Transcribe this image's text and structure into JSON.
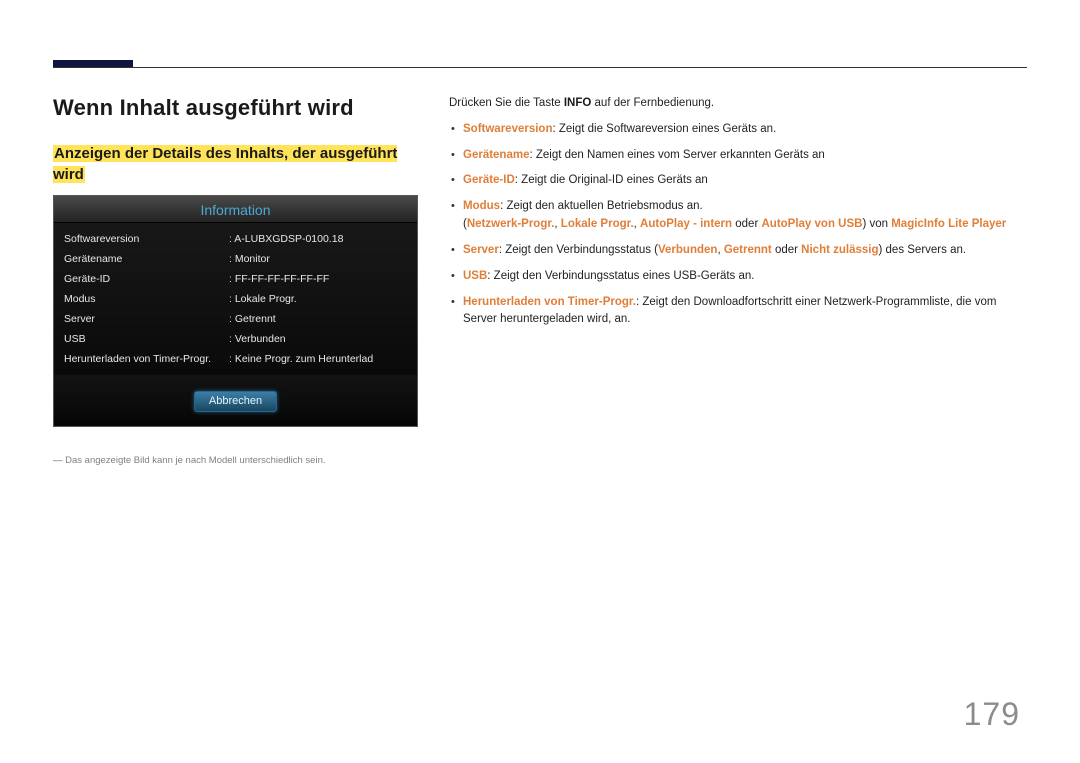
{
  "page_number": "179",
  "heading": "Wenn Inhalt ausgeführt wird",
  "subheading": "Anzeigen der Details des Inhalts, der ausgeführt wird",
  "panel": {
    "title": "Information",
    "rows": [
      {
        "k": "Softwareversion",
        "v": "A-LUBXGDSP-0100.18"
      },
      {
        "k": "Gerätename",
        "v": "Monitor"
      },
      {
        "k": "Geräte-ID",
        "v": "FF-FF-FF-FF-FF-FF"
      },
      {
        "k": "Modus",
        "v": "Lokale Progr."
      },
      {
        "k": "Server",
        "v": "Getrennt"
      },
      {
        "k": "USB",
        "v": "Verbunden"
      },
      {
        "k": "Herunterladen von Timer-Progr.",
        "v": "Keine Progr. zum Herunterlad"
      }
    ],
    "cancel": "Abbrechen"
  },
  "footnote": "Das angezeigte Bild kann je nach Modell unterschiedlich sein.",
  "right": {
    "intro_pre": "Drücken Sie die Taste ",
    "intro_bold": "INFO",
    "intro_post": " auf der Fernbedienung.",
    "items": {
      "softwareversion": {
        "term": "Softwareversion",
        "rest": ": Zeigt die Softwareversion eines Geräts an."
      },
      "geraetename": {
        "term": "Gerätename",
        "rest": ": Zeigt den Namen eines vom Server erkannten Geräts an"
      },
      "geraeteid": {
        "term": "Geräte-ID",
        "rest": ": Zeigt die Original-ID eines Geräts an"
      },
      "modus": {
        "term": "Modus",
        "rest": ": Zeigt den aktuellen Betriebsmodus an."
      },
      "modus_sub": {
        "open": "(",
        "a": "Netzwerk-Progr.",
        "s1": ", ",
        "b": "Lokale Progr.",
        "s2": ", ",
        "c": "AutoPlay - intern",
        "s3": " oder ",
        "d": "AutoPlay von USB",
        "close_pre": ") von ",
        "player": "MagicInfo Lite Player"
      },
      "server": {
        "term": "Server",
        "rest1": ": Zeigt den Verbindungsstatus (",
        "a": "Verbunden",
        "s1": ", ",
        "b": "Getrennt",
        "s2": " oder ",
        "c": "Nicht zulässig",
        "rest2": ") des Servers an."
      },
      "usb": {
        "term": "USB",
        "rest": ": Zeigt den Verbindungsstatus eines USB-Geräts an."
      },
      "download": {
        "term": "Herunterladen von Timer-Progr.",
        "rest": ": Zeigt den Downloadfortschritt einer Netzwerk-Programmliste, die vom Server heruntergeladen wird, an."
      }
    }
  }
}
